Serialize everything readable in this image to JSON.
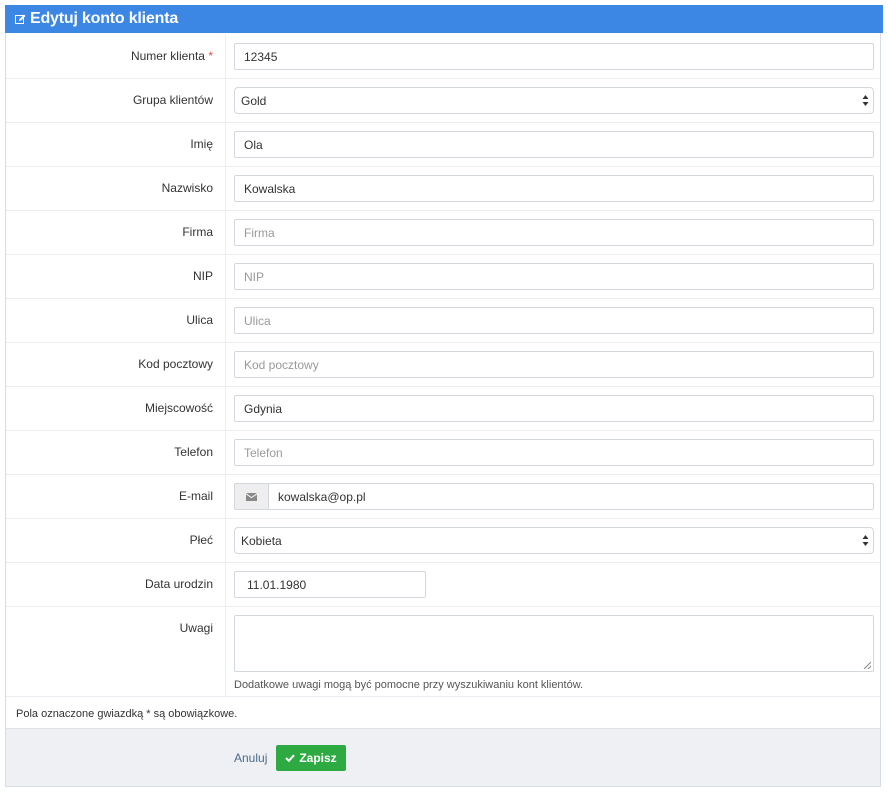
{
  "header": {
    "title": "Edytuj konto klienta",
    "icon": "edit-icon"
  },
  "fields": {
    "customer_number": {
      "label": "Numer klienta",
      "required_mark": "*",
      "value": "12345"
    },
    "customer_group": {
      "label": "Grupa klientów",
      "value": "Gold"
    },
    "first_name": {
      "label": "Imię",
      "value": "Ola"
    },
    "last_name": {
      "label": "Nazwisko",
      "value": "Kowalska"
    },
    "company": {
      "label": "Firma",
      "placeholder": "Firma"
    },
    "nip": {
      "label": "NIP",
      "placeholder": "NIP"
    },
    "street": {
      "label": "Ulica",
      "placeholder": "Ulica"
    },
    "postal_code": {
      "label": "Kod pocztowy",
      "placeholder": "Kod pocztowy"
    },
    "city": {
      "label": "Miejscowość",
      "value": "Gdynia"
    },
    "phone": {
      "label": "Telefon",
      "placeholder": "Telefon"
    },
    "email": {
      "label": "E-mail",
      "value": "kowalska@op.pl",
      "icon": "envelope-icon"
    },
    "gender": {
      "label": "Płeć",
      "value": "Kobieta"
    },
    "birth_date": {
      "label": "Data urodzin",
      "value": "11.01.1980"
    },
    "notes": {
      "label": "Uwagi",
      "value": "",
      "help": "Dodatkowe uwagi mogą być pomocne przy wyszukiwaniu kont klientów."
    }
  },
  "required_note": "Pola oznaczone gwiazdką * są obowiązkowe.",
  "footer": {
    "cancel_label": "Anuluj",
    "save_label": "Zapisz",
    "save_icon": "check-icon"
  },
  "colors": {
    "header": "#3d87e4",
    "save_button": "#2eaa43",
    "required": "#d9534f"
  }
}
